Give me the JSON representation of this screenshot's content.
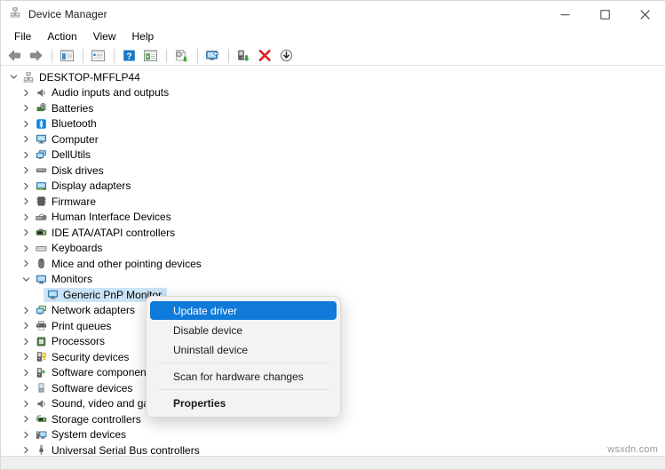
{
  "window": {
    "title": "Device Manager",
    "app_icon": "device-manager-icon",
    "controls": {
      "minimize": "—",
      "maximize": "□",
      "close": "✕"
    }
  },
  "menubar": {
    "items": [
      {
        "label": "File",
        "name": "menu-file"
      },
      {
        "label": "Action",
        "name": "menu-action"
      },
      {
        "label": "View",
        "name": "menu-view"
      },
      {
        "label": "Help",
        "name": "menu-help"
      }
    ]
  },
  "toolbar": {
    "buttons": [
      {
        "name": "back-arrow-icon",
        "title": "Back"
      },
      {
        "name": "forward-arrow-icon",
        "title": "Forward"
      },
      {
        "sep": true
      },
      {
        "name": "show-hide-console-tree-icon",
        "title": "Show/Hide Console Tree"
      },
      {
        "sep": true
      },
      {
        "name": "properties-icon",
        "title": "Properties"
      },
      {
        "sep": true
      },
      {
        "name": "help-icon",
        "title": "Help"
      },
      {
        "name": "view-icon",
        "title": "View"
      },
      {
        "sep": true
      },
      {
        "name": "update-driver-icon",
        "title": "Update driver"
      },
      {
        "sep": true
      },
      {
        "name": "scan-hardware-changes-icon",
        "title": "Scan for hardware changes"
      },
      {
        "sep": true
      },
      {
        "name": "enable-device-icon",
        "title": "Enable device"
      },
      {
        "name": "uninstall-device-icon",
        "title": "Uninstall device"
      },
      {
        "name": "disable-device-icon",
        "title": "Disable device"
      }
    ]
  },
  "tree": {
    "nodes": [
      {
        "label": "DESKTOP-MFFLP44",
        "depth": 0,
        "state": "expanded",
        "icon": "computer-root-icon",
        "selected": false
      },
      {
        "label": "Audio inputs and outputs",
        "depth": 1,
        "state": "collapsed",
        "icon": "speaker-icon",
        "selected": false
      },
      {
        "label": "Batteries",
        "depth": 1,
        "state": "collapsed",
        "icon": "battery-icon",
        "selected": false
      },
      {
        "label": "Bluetooth",
        "depth": 1,
        "state": "collapsed",
        "icon": "bluetooth-icon",
        "selected": false
      },
      {
        "label": "Computer",
        "depth": 1,
        "state": "collapsed",
        "icon": "monitor-icon",
        "selected": false
      },
      {
        "label": "DellUtils",
        "depth": 1,
        "state": "collapsed",
        "icon": "dell-utils-icon",
        "selected": false
      },
      {
        "label": "Disk drives",
        "depth": 1,
        "state": "collapsed",
        "icon": "disk-drive-icon",
        "selected": false
      },
      {
        "label": "Display adapters",
        "depth": 1,
        "state": "collapsed",
        "icon": "display-adapter-icon",
        "selected": false
      },
      {
        "label": "Firmware",
        "depth": 1,
        "state": "collapsed",
        "icon": "firmware-icon",
        "selected": false
      },
      {
        "label": "Human Interface Devices",
        "depth": 1,
        "state": "collapsed",
        "icon": "hid-icon",
        "selected": false
      },
      {
        "label": "IDE ATA/ATAPI controllers",
        "depth": 1,
        "state": "collapsed",
        "icon": "ide-controller-icon",
        "selected": false
      },
      {
        "label": "Keyboards",
        "depth": 1,
        "state": "collapsed",
        "icon": "keyboard-icon",
        "selected": false
      },
      {
        "label": "Mice and other pointing devices",
        "depth": 1,
        "state": "collapsed",
        "icon": "mouse-icon",
        "selected": false
      },
      {
        "label": "Monitors",
        "depth": 1,
        "state": "expanded",
        "icon": "monitor-icon",
        "selected": false
      },
      {
        "label": "Generic PnP Monitor",
        "depth": 2,
        "state": "leaf",
        "icon": "monitor-icon",
        "selected": true
      },
      {
        "label": "Network adapters",
        "depth": 1,
        "state": "collapsed",
        "icon": "network-adapter-icon",
        "selected": false
      },
      {
        "label": "Print queues",
        "depth": 1,
        "state": "collapsed",
        "icon": "printer-icon",
        "selected": false
      },
      {
        "label": "Processors",
        "depth": 1,
        "state": "collapsed",
        "icon": "processor-icon",
        "selected": false
      },
      {
        "label": "Security devices",
        "depth": 1,
        "state": "collapsed",
        "icon": "security-device-icon",
        "selected": false
      },
      {
        "label": "Software components",
        "depth": 1,
        "state": "collapsed",
        "icon": "software-component-icon",
        "selected": false
      },
      {
        "label": "Software devices",
        "depth": 1,
        "state": "collapsed",
        "icon": "software-device-icon",
        "selected": false
      },
      {
        "label": "Sound, video and game controllers",
        "depth": 1,
        "state": "collapsed",
        "icon": "speaker-icon",
        "selected": false
      },
      {
        "label": "Storage controllers",
        "depth": 1,
        "state": "collapsed",
        "icon": "storage-controller-icon",
        "selected": false
      },
      {
        "label": "System devices",
        "depth": 1,
        "state": "collapsed",
        "icon": "system-device-icon",
        "selected": false
      },
      {
        "label": "Universal Serial Bus controllers",
        "depth": 1,
        "state": "collapsed",
        "icon": "usb-icon",
        "selected": false
      }
    ]
  },
  "context_menu": {
    "items": [
      {
        "label": "Update driver",
        "name": "ctx-update-driver",
        "highlighted": true,
        "bold": false
      },
      {
        "label": "Disable device",
        "name": "ctx-disable-device",
        "highlighted": false,
        "bold": false
      },
      {
        "label": "Uninstall device",
        "name": "ctx-uninstall-device",
        "highlighted": false,
        "bold": false
      },
      {
        "sep": true
      },
      {
        "label": "Scan for hardware changes",
        "name": "ctx-scan-hardware-changes",
        "highlighted": false,
        "bold": false
      },
      {
        "sep": true
      },
      {
        "label": "Properties",
        "name": "ctx-properties",
        "highlighted": false,
        "bold": true
      }
    ]
  },
  "watermark": {
    "text": "wsxdn.com"
  },
  "colors": {
    "selection_blue": "#cce4f7",
    "menu_highlight": "#0f7ad9",
    "accent_red": "#e02020",
    "accent_green": "#3da23d",
    "bluetooth_blue": "#0a84d8",
    "window_bg": "#ffffff",
    "menu_bg": "#f3f3f3"
  }
}
